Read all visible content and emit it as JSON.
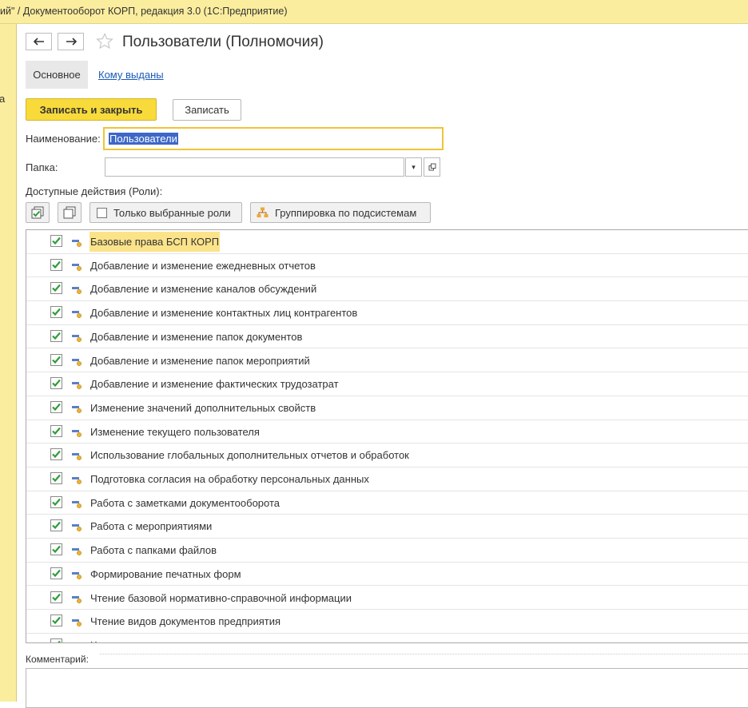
{
  "window": {
    "title": "ий\" / Документооборот КОРП, редакция 3.0  (1С:Предприятие)"
  },
  "leftstrip_char": "а",
  "header": {
    "title": "Пользователи (Полномочия)"
  },
  "icons": [
    "arrow-left-icon",
    "arrow-right-icon",
    "star-icon",
    "dropdown-icon",
    "open-icon",
    "check-all-icon",
    "uncheck-all-icon",
    "checkbox-icon",
    "hierarchy-icon",
    "role-icon"
  ],
  "tabs": {
    "main": "Основное",
    "issued": "Кому выданы"
  },
  "toolbar": {
    "save_close": "Записать и закрыть",
    "save": "Записать"
  },
  "form": {
    "name_label": "Наименование:",
    "name_value": "Пользователи",
    "folder_label": "Папка:",
    "folder_value": "",
    "roles_label": "Доступные действия (Роли):",
    "comment_label": "Комментарий:",
    "comment_value": ""
  },
  "roles_toolbar": {
    "only_selected": "Только выбранные роли",
    "group_by": "Группировка по подсистемам"
  },
  "colors": {
    "accent_yellow": "#f8db3b",
    "titlebar": "#fbed9e",
    "selection": "#3d67c8",
    "link": "#1a5bb4",
    "check": "#2e9d3a"
  },
  "roles": [
    {
      "label": "Базовые права БСП КОРП",
      "checked": true,
      "selected": true
    },
    {
      "label": "Добавление и изменение ежедневных отчетов",
      "checked": true
    },
    {
      "label": "Добавление и изменение каналов обсуждений",
      "checked": true
    },
    {
      "label": "Добавление и изменение контактных лиц контрагентов",
      "checked": true
    },
    {
      "label": "Добавление и изменение папок документов",
      "checked": true
    },
    {
      "label": "Добавление и изменение папок мероприятий",
      "checked": true
    },
    {
      "label": "Добавление и изменение фактических трудозатрат",
      "checked": true
    },
    {
      "label": "Изменение значений дополнительных свойств",
      "checked": true
    },
    {
      "label": "Изменение текущего пользователя",
      "checked": true
    },
    {
      "label": "Использование глобальных дополнительных отчетов и обработок",
      "checked": true
    },
    {
      "label": "Подготовка согласия на обработку персональных данных",
      "checked": true
    },
    {
      "label": "Работа с заметками документооборота",
      "checked": true
    },
    {
      "label": "Работа с мероприятиями",
      "checked": true
    },
    {
      "label": "Работа с папками файлов",
      "checked": true
    },
    {
      "label": "Формирование печатных форм",
      "checked": true
    },
    {
      "label": "Чтение базовой нормативно-справочной информации",
      "checked": true
    },
    {
      "label": "Чтение видов документов предприятия",
      "checked": true
    },
    {
      "label": "Ч",
      "checked": true
    }
  ]
}
